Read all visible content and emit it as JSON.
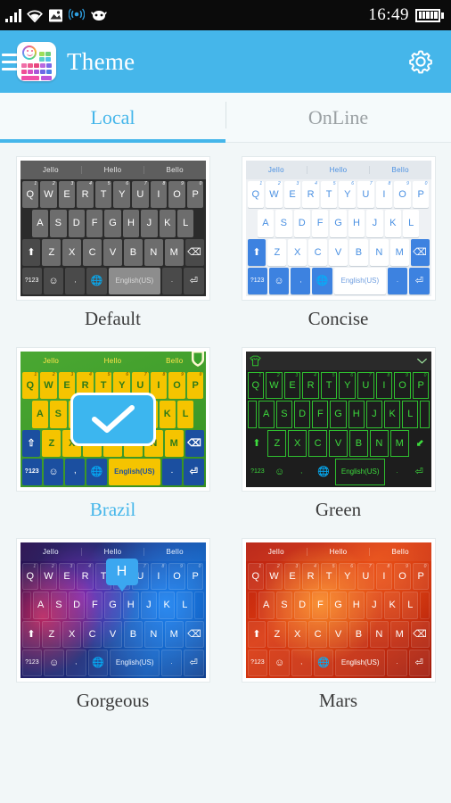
{
  "statusbar": {
    "time": "16:49",
    "icons": [
      "signal-icon",
      "wifi-icon",
      "screenshot-icon",
      "wireless-broadcast-icon",
      "android-head-icon"
    ],
    "battery": "battery-full-icon"
  },
  "appbar": {
    "menu_icon": "hamburger-menu-icon",
    "app_icon": "keyboard-theme-app-icon",
    "title": "Theme",
    "settings_icon": "gear-icon",
    "background": "#45b6ea"
  },
  "tabs": {
    "items": [
      {
        "label": "Local",
        "active": true
      },
      {
        "label": "OnLine",
        "active": false
      }
    ],
    "accent": "#45b6ea"
  },
  "keyboard_preview": {
    "suggestions": [
      "Jello",
      "Hello",
      "Bello"
    ],
    "row1": [
      {
        "k": "Q",
        "n": "1"
      },
      {
        "k": "W",
        "n": "2"
      },
      {
        "k": "E",
        "n": "3"
      },
      {
        "k": "R",
        "n": "4"
      },
      {
        "k": "T",
        "n": "5"
      },
      {
        "k": "Y",
        "n": "6"
      },
      {
        "k": "U",
        "n": "7"
      },
      {
        "k": "I",
        "n": "8"
      },
      {
        "k": "O",
        "n": "9"
      },
      {
        "k": "P",
        "n": "0"
      }
    ],
    "row2": [
      "A",
      "S",
      "D",
      "F",
      "G",
      "H",
      "J",
      "K",
      "L"
    ],
    "row3": [
      "Z",
      "X",
      "C",
      "V",
      "B",
      "N",
      "M"
    ],
    "shift_key": "shift-arrow-icon",
    "backspace_key": "backspace-icon",
    "symbols_key": "?123",
    "emoji_key": "emoji-smiley-icon",
    "comma_key": ",",
    "globe_key": "globe-language-icon",
    "space_key": "English(US)",
    "period_key": ".",
    "enter_key": "enter-return-icon"
  },
  "themes": [
    {
      "name": "Default",
      "id": "t-default",
      "selected": false,
      "accent": "#6d6d6d"
    },
    {
      "name": "Concise",
      "id": "t-concise",
      "selected": false,
      "accent": "#3d82e0"
    },
    {
      "name": "Brazil",
      "id": "t-brazil",
      "selected": true,
      "accent": "#f5c400"
    },
    {
      "name": "Green",
      "id": "t-green",
      "selected": false,
      "accent": "#3ddc3d"
    },
    {
      "name": "Gorgeous",
      "id": "t-gorgeous",
      "selected": false,
      "accent": "#3ba7f0"
    },
    {
      "name": "Mars",
      "id": "t-mars",
      "selected": false,
      "accent": "#d9380f"
    }
  ],
  "overlays": {
    "selected_check": "check-mark-icon",
    "brazil_badge": "shield-badge-icon",
    "green_shirt": "t-shirt-icon",
    "green_chevron": "chevron-down-icon",
    "gorgeous_popup_key": "H"
  },
  "page": {
    "background": "#f2f7f8",
    "label_color": "#3c3c3c",
    "selected_label_color": "#45b6ea"
  }
}
